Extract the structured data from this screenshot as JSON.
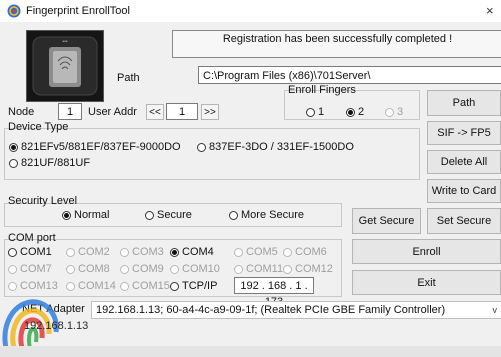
{
  "window": {
    "title": "Fingerprint EnrollTool",
    "close": "×"
  },
  "status": {
    "message": "Registration has been successfully completed !"
  },
  "path": {
    "label": "Path",
    "value": "C:\\Program Files (x86)\\701Server\\"
  },
  "node": {
    "label": "Node",
    "value": "1"
  },
  "user_addr": {
    "label": "User Addr",
    "prev": "<<",
    "value": "1",
    "next": ">>"
  },
  "enroll_fingers": {
    "title": "Enroll Fingers",
    "options": [
      {
        "label": "1",
        "selected": false,
        "enabled": true
      },
      {
        "label": "2",
        "selected": true,
        "enabled": true
      },
      {
        "label": "3",
        "selected": false,
        "enabled": false
      }
    ]
  },
  "device_type": {
    "title": "Device Type",
    "options": [
      {
        "label": "821EFv5/881EF/837EF-9000DO",
        "selected": true
      },
      {
        "label": "837EF-3DO / 331EF-1500DO",
        "selected": false
      },
      {
        "label": "821UF/881UF",
        "selected": false
      }
    ]
  },
  "security_level": {
    "title": "Security Level",
    "options": [
      {
        "label": "Normal",
        "selected": true
      },
      {
        "label": "Secure",
        "selected": false
      },
      {
        "label": "More Secure",
        "selected": false
      }
    ]
  },
  "com_port": {
    "title": "COM port",
    "rows": [
      [
        {
          "label": "COM1",
          "selected": false,
          "enabled": true
        },
        {
          "label": "COM2",
          "selected": false,
          "enabled": false
        },
        {
          "label": "COM3",
          "selected": false,
          "enabled": false
        },
        {
          "label": "COM4",
          "selected": true,
          "enabled": true
        },
        {
          "label": "COM5",
          "selected": false,
          "enabled": false
        },
        {
          "label": "COM6",
          "selected": false,
          "enabled": false
        }
      ],
      [
        {
          "label": "COM7",
          "selected": false,
          "enabled": false
        },
        {
          "label": "COM8",
          "selected": false,
          "enabled": false
        },
        {
          "label": "COM9",
          "selected": false,
          "enabled": false
        },
        {
          "label": "COM10",
          "selected": false,
          "enabled": false
        },
        {
          "label": "COM11",
          "selected": false,
          "enabled": false
        },
        {
          "label": "COM12",
          "selected": false,
          "enabled": false
        }
      ],
      [
        {
          "label": "COM13",
          "selected": false,
          "enabled": false
        },
        {
          "label": "COM14",
          "selected": false,
          "enabled": false
        },
        {
          "label": "COM15",
          "selected": false,
          "enabled": false
        },
        {
          "label": "TCP/IP",
          "selected": false,
          "enabled": true
        }
      ]
    ],
    "ip": "192 . 168 .  1  . 173"
  },
  "net_adapter": {
    "label": "NET Adapter",
    "value": "192.168.1.13; 60-a4-4c-a9-09-1f; (Realtek PCIe GBE Family Controller)",
    "arrow": "v",
    "overlay_ip": "192.168.1.13"
  },
  "buttons": {
    "path": "Path",
    "sif_fp5": "SIF -> FP5",
    "delete_all": "Delete All",
    "write_to_card": "Write to Card",
    "get_secure": "Get Secure",
    "set_secure": "Set Secure",
    "enroll": "Enroll",
    "exit": "Exit"
  }
}
